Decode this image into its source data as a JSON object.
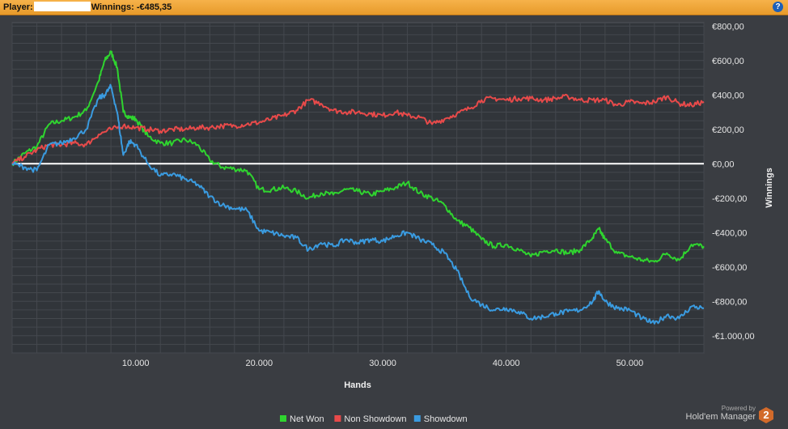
{
  "header": {
    "player_label": "Player:",
    "winnings_label": "Winnings:",
    "winnings_value": "-€485,35",
    "help_icon": "?"
  },
  "branding": {
    "powered_by": "Powered by",
    "product": "Hold'em Manager",
    "badge": "2"
  },
  "chart_data": {
    "type": "line",
    "xlabel": "Hands",
    "ylabel": "Winnings",
    "xlim": [
      0,
      56000
    ],
    "ylim": [
      -1100,
      820
    ],
    "x_ticks": [
      10000,
      20000,
      30000,
      40000,
      50000
    ],
    "x_tick_labels": [
      "10.000",
      "20.000",
      "30.000",
      "40.000",
      "50.000"
    ],
    "y_ticks": [
      800,
      600,
      400,
      200,
      0,
      -200,
      -400,
      -600,
      -800,
      -1000
    ],
    "y_tick_labels": [
      "€800,00",
      "€600,00",
      "€400,00",
      "€200,00",
      "€0,00",
      "-€200,00",
      "-€400,00",
      "-€600,00",
      "-€800,00",
      "-€1.000,00"
    ],
    "grid": true,
    "legend_position": "bottom-center",
    "series": [
      {
        "name": "Net Won",
        "color": "#2fd42f",
        "x": [
          0,
          1000,
          2000,
          3000,
          4000,
          5000,
          6000,
          7000,
          7500,
          8000,
          8500,
          9000,
          9500,
          10000,
          11000,
          12000,
          13000,
          14000,
          15000,
          16000,
          17000,
          18000,
          19000,
          20000,
          21000,
          22000,
          23000,
          24000,
          25000,
          26000,
          27000,
          28000,
          29000,
          30000,
          31000,
          32000,
          33000,
          34000,
          35000,
          36000,
          37000,
          38000,
          39000,
          40000,
          41000,
          42000,
          43000,
          44000,
          45000,
          46000,
          47000,
          47500,
          48000,
          49000,
          50000,
          51000,
          52000,
          53000,
          54000,
          55000,
          56000
        ],
        "y": [
          0,
          60,
          100,
          230,
          250,
          270,
          310,
          480,
          600,
          650,
          560,
          300,
          270,
          260,
          160,
          120,
          120,
          140,
          110,
          20,
          -20,
          -30,
          -40,
          -150,
          -150,
          -140,
          -160,
          -200,
          -170,
          -180,
          -150,
          -160,
          -180,
          -160,
          -140,
          -110,
          -170,
          -200,
          -240,
          -330,
          -370,
          -440,
          -480,
          -470,
          -500,
          -540,
          -510,
          -500,
          -520,
          -500,
          -430,
          -380,
          -440,
          -520,
          -540,
          -560,
          -570,
          -520,
          -560,
          -470,
          -480
        ]
      },
      {
        "name": "Non Showdown",
        "color": "#e84a4a",
        "x": [
          0,
          1000,
          2000,
          3000,
          4000,
          5000,
          6000,
          7000,
          8000,
          9000,
          10000,
          11000,
          12000,
          13000,
          14000,
          15000,
          16000,
          17000,
          18000,
          19000,
          20000,
          21000,
          22000,
          23000,
          24000,
          25000,
          26000,
          27000,
          28000,
          29000,
          30000,
          31000,
          32000,
          33000,
          34000,
          35000,
          36000,
          37000,
          38000,
          39000,
          40000,
          41000,
          42000,
          43000,
          44000,
          45000,
          46000,
          47000,
          48000,
          49000,
          50000,
          51000,
          52000,
          53000,
          54000,
          55000,
          56000
        ],
        "y": [
          0,
          40,
          80,
          110,
          110,
          120,
          110,
          170,
          200,
          220,
          210,
          200,
          190,
          200,
          200,
          210,
          210,
          220,
          220,
          230,
          240,
          260,
          280,
          310,
          370,
          350,
          310,
          300,
          300,
          290,
          280,
          300,
          280,
          270,
          230,
          260,
          290,
          320,
          370,
          380,
          370,
          380,
          380,
          370,
          380,
          390,
          370,
          370,
          370,
          340,
          360,
          350,
          360,
          390,
          350,
          340,
          360
        ]
      },
      {
        "name": "Showdown",
        "color": "#3a9be0",
        "x": [
          0,
          1000,
          2000,
          3000,
          4000,
          5000,
          6000,
          7000,
          7500,
          8000,
          8500,
          9000,
          9500,
          10000,
          11000,
          12000,
          13000,
          14000,
          15000,
          16000,
          17000,
          18000,
          19000,
          20000,
          21000,
          22000,
          23000,
          24000,
          25000,
          26000,
          27000,
          28000,
          29000,
          30000,
          31000,
          32000,
          33000,
          34000,
          35000,
          36000,
          37000,
          38000,
          39000,
          40000,
          41000,
          42000,
          43000,
          44000,
          45000,
          46000,
          47000,
          47500,
          48000,
          49000,
          50000,
          51000,
          52000,
          53000,
          54000,
          55000,
          56000
        ],
        "y": [
          0,
          -20,
          -40,
          110,
          120,
          150,
          200,
          380,
          400,
          450,
          300,
          50,
          130,
          110,
          0,
          -70,
          -60,
          -90,
          -120,
          -190,
          -240,
          -260,
          -270,
          -390,
          -400,
          -420,
          -430,
          -500,
          -460,
          -480,
          -440,
          -460,
          -440,
          -450,
          -420,
          -400,
          -440,
          -470,
          -520,
          -620,
          -770,
          -820,
          -850,
          -840,
          -860,
          -900,
          -890,
          -870,
          -860,
          -850,
          -800,
          -740,
          -800,
          -840,
          -850,
          -900,
          -930,
          -880,
          -900,
          -830,
          -840
        ]
      }
    ]
  }
}
